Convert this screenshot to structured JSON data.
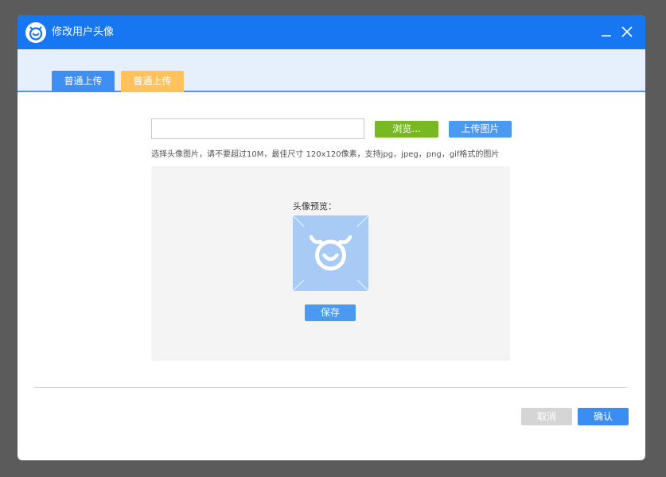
{
  "window": {
    "title": "修改用户头像"
  },
  "tabs": [
    {
      "label": "普通上传"
    },
    {
      "label": "普通上传"
    }
  ],
  "upload": {
    "file_value": "",
    "browse_label": "浏览...",
    "upload_label": "上传图片",
    "hint": "选择头像图片，请不要超过10M，最佳尺寸 120x120像素，支持jpg，jpeg，png，gif格式的图片"
  },
  "preview": {
    "label": "头像预览：",
    "save_label": "保存"
  },
  "footer": {
    "cancel_label": "取消",
    "confirm_label": "确认"
  },
  "colors": {
    "titlebar": "#1677f0",
    "browse": "#78b923",
    "active_tab": "#3f8ff2",
    "hover_tab": "#ffc25c",
    "primary": "#3a8df1",
    "disabled": "#d5d5d5"
  },
  "icons": {
    "logo": "smiley-logo-icon",
    "minimize": "minimize-icon",
    "close": "close-icon",
    "avatar_placeholder": "smiley-avatar-icon"
  }
}
